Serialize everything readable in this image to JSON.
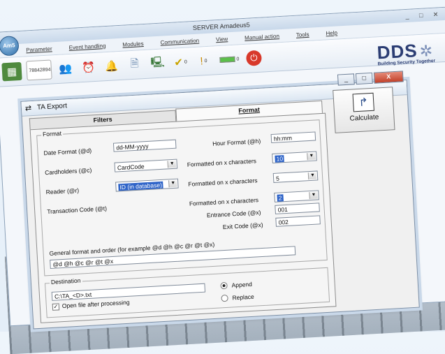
{
  "app": {
    "title": "SERVER Amadeus5",
    "logo_text": "Am5",
    "window_controls": "_ □ ✕"
  },
  "menu": [
    "Parameter",
    "Event handling",
    "Modules",
    "Communication",
    "View",
    "Manual action",
    "Tools",
    "Help"
  ],
  "toolbar": {
    "counter_label": "78842894",
    "ok_count": "0",
    "warn_count": "0",
    "status_count": "0"
  },
  "brand": {
    "name": "DDS",
    "tagline": "Building Security Together"
  },
  "dialog": {
    "title": "TA Export",
    "min": "_",
    "max": "□",
    "close": "X",
    "tabs": [
      {
        "label": "Filters",
        "active": false
      },
      {
        "label": "Format",
        "active": true
      }
    ],
    "calculate_label": "Calculate"
  },
  "format": {
    "legend": "Format",
    "date_format_label": "Date Format (@d)",
    "date_format_value": "dd-MM-yyyy",
    "hour_format_label": "Hour Format (@h)",
    "hour_format_value": "hh:mm",
    "cardholders_label": "Cardholders (@c)",
    "cardholders_value": "CardCode",
    "cardholders_chars_label": "Formatted on x characters",
    "cardholders_chars_value": "10",
    "reader_label": "Reader (@r)",
    "reader_value": "ID (in database)",
    "reader_chars_label": "Formatted on x characters",
    "reader_chars_value": "5",
    "transaction_label": "Transaction Code (@t)",
    "transaction_chars_label": "Formatted on x characters",
    "transaction_chars_value": "2",
    "entrance_label": "Entrance Code (@x)",
    "entrance_value": "001",
    "exit_label": "Exit Code (@x)",
    "exit_value": "002",
    "general_label": "General format and order  (for example  @d @h @c @r @t @x)",
    "general_value": "@d @h @c @r @t @x"
  },
  "destination": {
    "legend": "Destination",
    "path_value": "C:\\TA_<D>.txt",
    "open_after_label": "Open file after processing",
    "open_after_checked": true,
    "append_label": "Append",
    "replace_label": "Replace",
    "selected": "Append"
  }
}
